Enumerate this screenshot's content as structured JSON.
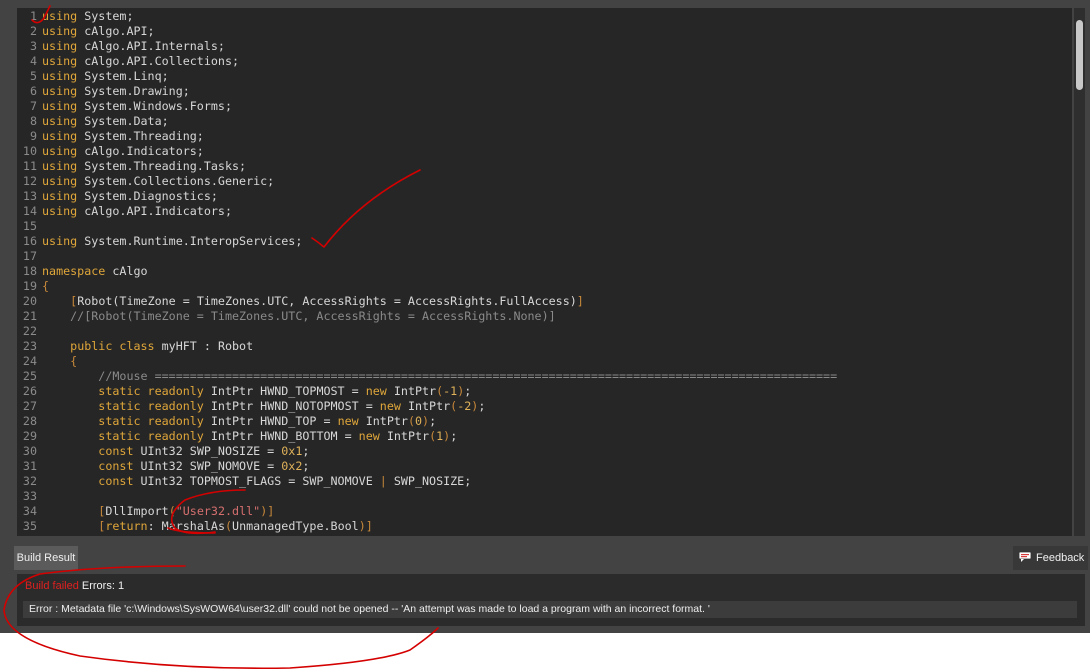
{
  "editor": {
    "lines": [
      {
        "n": "1",
        "parts": [
          [
            "kw",
            "using"
          ],
          [
            "ct",
            " System;"
          ]
        ]
      },
      {
        "n": "2",
        "parts": [
          [
            "kw",
            "using"
          ],
          [
            "ct",
            " cAlgo.API;"
          ]
        ]
      },
      {
        "n": "3",
        "parts": [
          [
            "kw",
            "using"
          ],
          [
            "ct",
            " cAlgo.API.Internals;"
          ]
        ]
      },
      {
        "n": "4",
        "parts": [
          [
            "kw",
            "using"
          ],
          [
            "ct",
            " cAlgo.API.Collections;"
          ]
        ]
      },
      {
        "n": "5",
        "parts": [
          [
            "kw",
            "using"
          ],
          [
            "ct",
            " System.Linq;"
          ]
        ]
      },
      {
        "n": "6",
        "parts": [
          [
            "kw",
            "using"
          ],
          [
            "ct",
            " System.Drawing;"
          ]
        ]
      },
      {
        "n": "7",
        "parts": [
          [
            "kw",
            "using"
          ],
          [
            "ct",
            " System.Windows.Forms;"
          ]
        ]
      },
      {
        "n": "8",
        "parts": [
          [
            "kw",
            "using"
          ],
          [
            "ct",
            " System.Data;"
          ]
        ]
      },
      {
        "n": "9",
        "parts": [
          [
            "kw",
            "using"
          ],
          [
            "ct",
            " System.Threading;"
          ]
        ]
      },
      {
        "n": "10",
        "parts": [
          [
            "kw",
            "using"
          ],
          [
            "ct",
            " cAlgo.Indicators;"
          ]
        ]
      },
      {
        "n": "11",
        "parts": [
          [
            "kw",
            "using"
          ],
          [
            "ct",
            " System.Threading.Tasks;"
          ]
        ]
      },
      {
        "n": "12",
        "parts": [
          [
            "kw",
            "using"
          ],
          [
            "ct",
            " System.Collections.Generic;"
          ]
        ]
      },
      {
        "n": "13",
        "parts": [
          [
            "kw",
            "using"
          ],
          [
            "ct",
            " System.Diagnostics;"
          ]
        ]
      },
      {
        "n": "14",
        "parts": [
          [
            "kw",
            "using"
          ],
          [
            "ct",
            " cAlgo.API.Indicators;"
          ]
        ]
      },
      {
        "n": "15",
        "parts": []
      },
      {
        "n": "16",
        "parts": [
          [
            "kw",
            "using"
          ],
          [
            "ct",
            " System.Runtime.InteropServices;"
          ]
        ]
      },
      {
        "n": "17",
        "parts": []
      },
      {
        "n": "18",
        "parts": [
          [
            "kw",
            "namespace"
          ],
          [
            "ct",
            " cAlgo"
          ]
        ]
      },
      {
        "n": "19",
        "parts": [
          [
            "br",
            "{"
          ]
        ]
      },
      {
        "n": "20",
        "parts": [
          [
            "ct",
            "    "
          ],
          [
            "br",
            "["
          ],
          [
            "ct",
            "Robot(TimeZone = TimeZones.UTC, AccessRights = AccessRights.FullAccess)"
          ],
          [
            "br",
            "]"
          ]
        ]
      },
      {
        "n": "21",
        "parts": [
          [
            "cm",
            "    //[Robot(TimeZone = TimeZones.UTC, AccessRights = AccessRights.None)]"
          ]
        ]
      },
      {
        "n": "22",
        "parts": []
      },
      {
        "n": "23",
        "parts": [
          [
            "ct",
            "    "
          ],
          [
            "kw",
            "public class"
          ],
          [
            "ct",
            " myHFT : Robot"
          ]
        ]
      },
      {
        "n": "24",
        "parts": [
          [
            "ct",
            "    "
          ],
          [
            "br",
            "{"
          ]
        ]
      },
      {
        "n": "25",
        "parts": [
          [
            "cm",
            "        //Mouse ================================================================================================="
          ]
        ]
      },
      {
        "n": "26",
        "parts": [
          [
            "ct",
            "        "
          ],
          [
            "kw",
            "static readonly"
          ],
          [
            "ct",
            " IntPtr HWND_TOPMOST = "
          ],
          [
            "kw",
            "new"
          ],
          [
            "ct",
            " IntPtr"
          ],
          [
            "br",
            "("
          ],
          [
            "num",
            "-1"
          ],
          [
            "br",
            ")"
          ],
          [
            "ct",
            ";"
          ]
        ]
      },
      {
        "n": "27",
        "parts": [
          [
            "ct",
            "        "
          ],
          [
            "kw",
            "static readonly"
          ],
          [
            "ct",
            " IntPtr HWND_NOTOPMOST = "
          ],
          [
            "kw",
            "new"
          ],
          [
            "ct",
            " IntPtr"
          ],
          [
            "br",
            "("
          ],
          [
            "num",
            "-2"
          ],
          [
            "br",
            ")"
          ],
          [
            "ct",
            ";"
          ]
        ]
      },
      {
        "n": "28",
        "parts": [
          [
            "ct",
            "        "
          ],
          [
            "kw",
            "static readonly"
          ],
          [
            "ct",
            " IntPtr HWND_TOP = "
          ],
          [
            "kw",
            "new"
          ],
          [
            "ct",
            " IntPtr"
          ],
          [
            "br",
            "("
          ],
          [
            "num",
            "0"
          ],
          [
            "br",
            ")"
          ],
          [
            "ct",
            ";"
          ]
        ]
      },
      {
        "n": "29",
        "parts": [
          [
            "ct",
            "        "
          ],
          [
            "kw",
            "static readonly"
          ],
          [
            "ct",
            " IntPtr HWND_BOTTOM = "
          ],
          [
            "kw",
            "new"
          ],
          [
            "ct",
            " IntPtr"
          ],
          [
            "br",
            "("
          ],
          [
            "num",
            "1"
          ],
          [
            "br",
            ")"
          ],
          [
            "ct",
            ";"
          ]
        ]
      },
      {
        "n": "30",
        "parts": [
          [
            "ct",
            "        "
          ],
          [
            "kw",
            "const"
          ],
          [
            "ct",
            " UInt32 SWP_NOSIZE = "
          ],
          [
            "num",
            "0x1"
          ],
          [
            "ct",
            ";"
          ]
        ]
      },
      {
        "n": "31",
        "parts": [
          [
            "ct",
            "        "
          ],
          [
            "kw",
            "const"
          ],
          [
            "ct",
            " UInt32 SWP_NOMOVE = "
          ],
          [
            "num",
            "0x2"
          ],
          [
            "ct",
            ";"
          ]
        ]
      },
      {
        "n": "32",
        "parts": [
          [
            "ct",
            "        "
          ],
          [
            "kw",
            "const"
          ],
          [
            "ct",
            " UInt32 TOPMOST_FLAGS = SWP_NOMOVE "
          ],
          [
            "br",
            "|"
          ],
          [
            "ct",
            " SWP_NOSIZE;"
          ]
        ]
      },
      {
        "n": "33",
        "parts": []
      },
      {
        "n": "34",
        "parts": [
          [
            "ct",
            "        "
          ],
          [
            "br",
            "["
          ],
          [
            "ct",
            "DllImport"
          ],
          [
            "br",
            "("
          ],
          [
            "str",
            "\"User32.dll\""
          ],
          [
            "br",
            ")]"
          ]
        ]
      },
      {
        "n": "35",
        "parts": [
          [
            "ct",
            "        "
          ],
          [
            "br",
            "["
          ],
          [
            "kw",
            "return"
          ],
          [
            "ct",
            ": MarshalAs"
          ],
          [
            "br",
            "("
          ],
          [
            "ct",
            "UnmanagedType.Bool"
          ],
          [
            "br",
            ")]"
          ]
        ]
      }
    ]
  },
  "build_tab": {
    "label": "Build Result"
  },
  "feedback": {
    "label": "Feedback",
    "icon": "feedback-bubble-icon"
  },
  "build": {
    "status": "Build failed",
    "errors_label": "Errors: 1",
    "error_message": "Error : Metadata file 'c:\\Windows\\SysWOW64\\user32.dll' could not be opened -- 'An attempt was made to load a program with an incorrect format. '"
  },
  "colors": {
    "background": "#434343",
    "editor_bg": "#262626",
    "keyword": "#dfa63a",
    "string": "#d56f6f",
    "error_red": "#e02020",
    "annotation_red": "#d40000"
  }
}
